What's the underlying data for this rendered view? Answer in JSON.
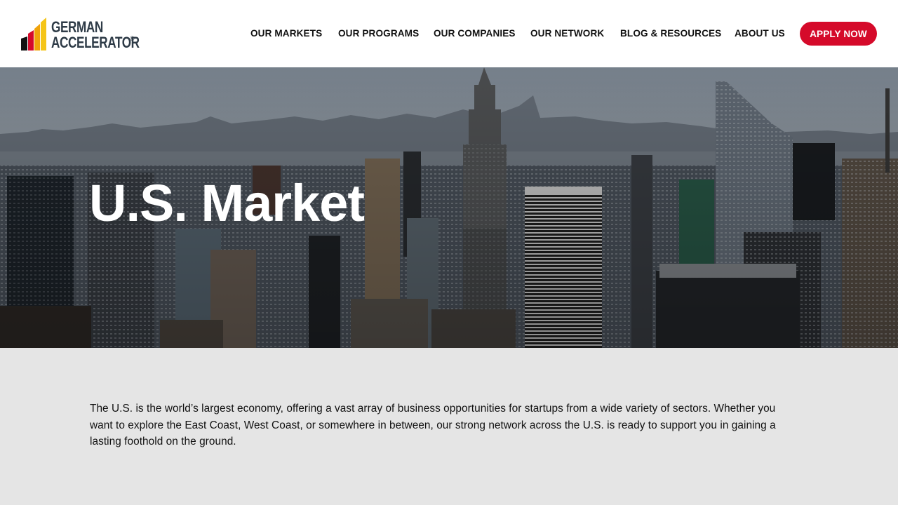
{
  "brand": {
    "line1": "GERMAN",
    "line2": "ACCELERATOR",
    "registered": "®",
    "colors": [
      "#111111",
      "#d50a2a",
      "#f0a30a",
      "#f5c518"
    ]
  },
  "nav": {
    "items": [
      {
        "label": "OUR MARKETS"
      },
      {
        "label": "OUR PROGRAMS"
      },
      {
        "label": "OUR COMPANIES"
      },
      {
        "label": "OUR NETWORK"
      },
      {
        "label": "BLOG & RESOURCES"
      },
      {
        "label": "ABOUT US"
      }
    ],
    "cta_label": "APPLY NOW",
    "cta_color": "#d50a2a"
  },
  "hero": {
    "title": "U.S. Market",
    "background": "new-york-skyline-photo"
  },
  "intro": {
    "text": "The U.S. is the world’s largest economy, offering a vast array of business opportunities for startups from a wide variety of sectors. Whether you want to explore the East Coast, West Coast, or somewhere in between, our strong network across the U.S. is ready to support you in gaining a lasting foothold on the ground."
  }
}
